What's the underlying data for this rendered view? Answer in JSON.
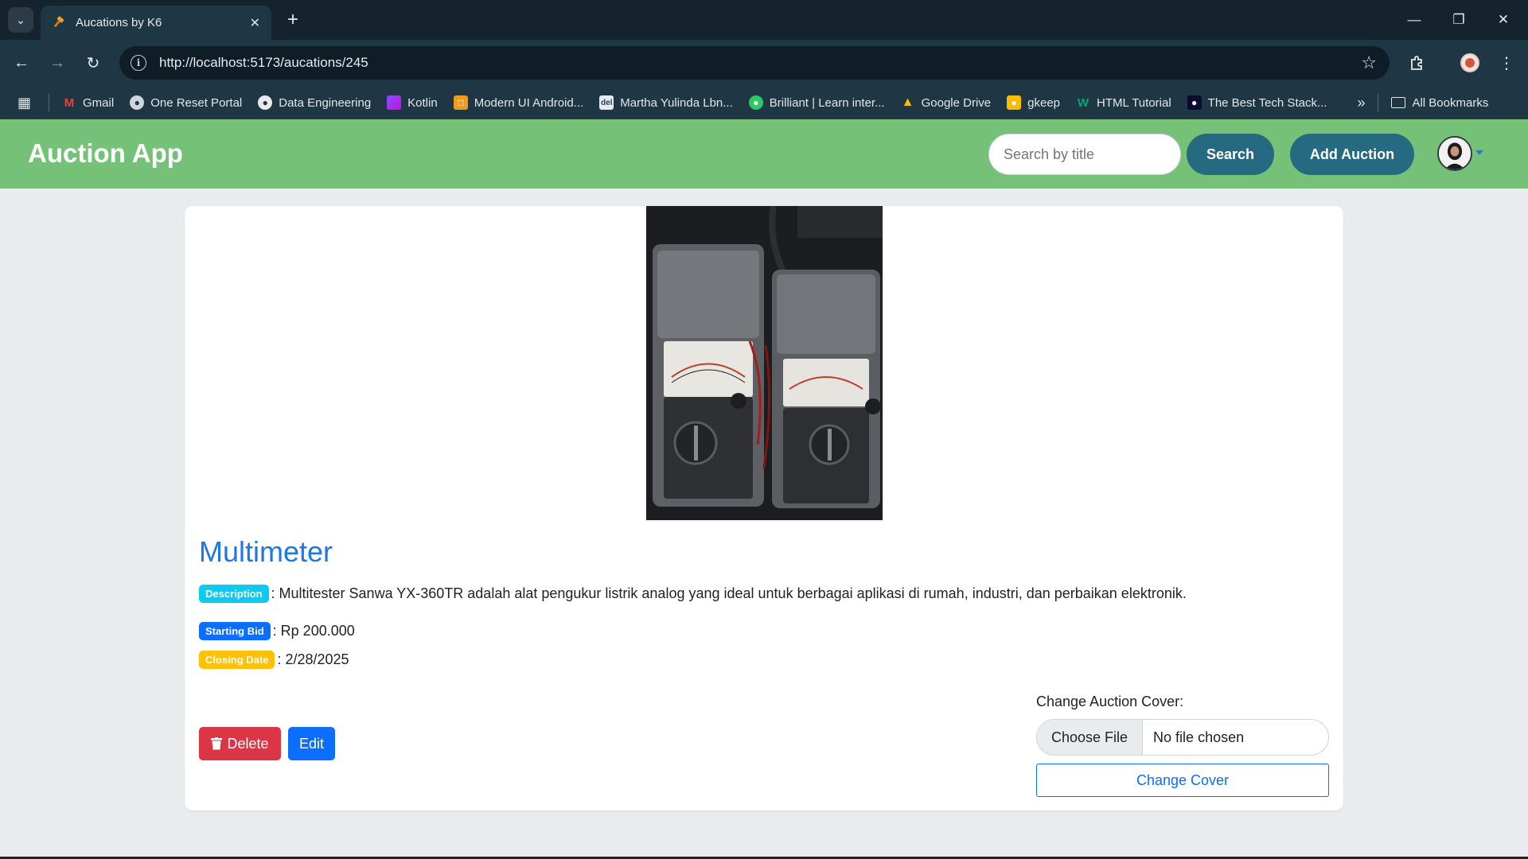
{
  "browser": {
    "tab_title": "Aucations by K6",
    "url": "http://localhost:5173/aucations/245",
    "bookmarks": [
      {
        "label": "Gmail",
        "icon": "gmail-icon"
      },
      {
        "label": "One Reset Portal",
        "icon": "globe-icon"
      },
      {
        "label": "Data Engineering",
        "icon": "github-icon"
      },
      {
        "label": "Kotlin",
        "icon": "kotlin-icon"
      },
      {
        "label": "Modern UI Android...",
        "icon": "bookmark-icon"
      },
      {
        "label": "Martha Yulinda Lbn...",
        "icon": "del-icon"
      },
      {
        "label": "Brilliant | Learn inter...",
        "icon": "brilliant-icon"
      },
      {
        "label": "Google Drive",
        "icon": "google-drive-icon"
      },
      {
        "label": "gkeep",
        "icon": "keep-icon"
      },
      {
        "label": "HTML Tutorial",
        "icon": "w3schools-icon"
      },
      {
        "label": "The Best Tech Stack...",
        "icon": "tech-stack-icon"
      }
    ],
    "all_bookmarks": "All Bookmarks"
  },
  "app": {
    "brand": "Auction App",
    "search_placeholder": "Search by title",
    "search_label": "Search",
    "add_label": "Add Auction",
    "accent_color": "#75c178",
    "button_color": "#266a81"
  },
  "item": {
    "title": "Multimeter",
    "description_badge": "Description",
    "description": ": Multitester Sanwa YX-360TR adalah alat pengukur listrik analog yang ideal untuk berbagai aplikasi di rumah, industri, dan perbaikan elektronik.",
    "bid_badge": "Starting Bid",
    "bid": ": Rp 200.000",
    "date_badge": "Closing Date",
    "date": ": 2/28/2025"
  },
  "actions": {
    "delete_label": "Delete",
    "edit_label": "Edit",
    "cover_label": "Change Auction Cover:",
    "choose_file": "Choose File",
    "no_file": "No file chosen",
    "change_cover": "Change Cover"
  }
}
